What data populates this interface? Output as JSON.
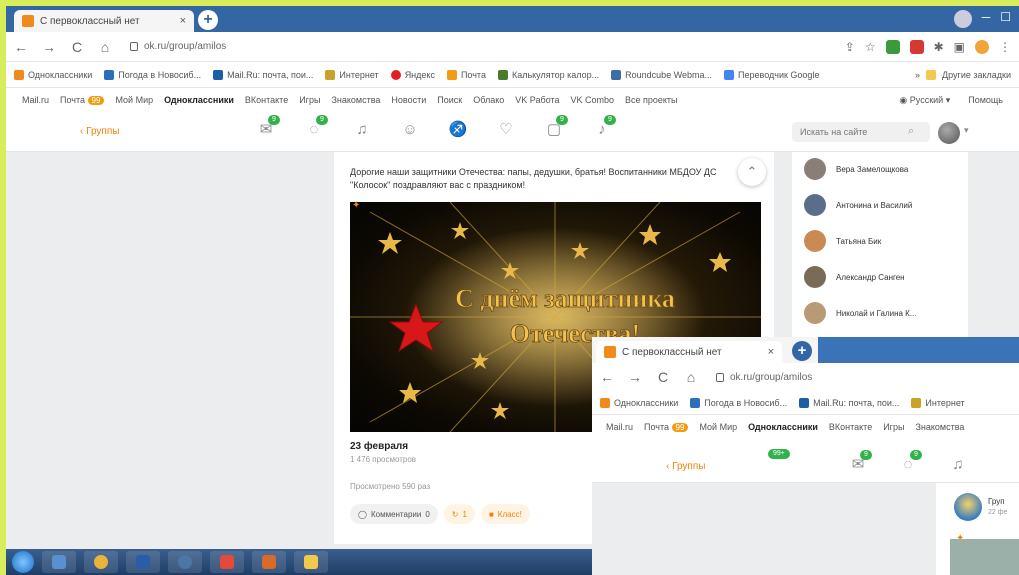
{
  "browser": {
    "tab_title": "С первоклассный нет",
    "tab_close": "×",
    "new_tab": "+",
    "url": "ok.ru/group/amilos"
  },
  "bookmarks": [
    {
      "label": "Одноклассники",
      "color": "#f08a1c"
    },
    {
      "label": "Погода в Новосиб...",
      "color": "#2a6fb8"
    },
    {
      "label": "Mail.Ru: почта, пои...",
      "color": "#1d5fa6"
    },
    {
      "label": "Интернет",
      "color": "#c9a227"
    },
    {
      "label": "Яндекс",
      "color": "#e02020"
    },
    {
      "label": "Почта",
      "color": "#f39c12"
    },
    {
      "label": "Калькулятор калор...",
      "color": "#4a7a2a"
    },
    {
      "label": "Roundcube Webma...",
      "color": "#3a6ea5"
    },
    {
      "label": "Переводчик Google",
      "color": "#4285f4"
    }
  ],
  "bookmarks_more": "Другие закладки",
  "portal": {
    "items": [
      "Mail.ru",
      "Почта",
      "Мой Мир",
      "Одноклассники",
      "ВКонтакте",
      "Игры",
      "Знакомства",
      "Новости",
      "Поиск",
      "Облако",
      "VK Работа",
      "VK Combo",
      "Все проекты"
    ],
    "mail_badge": "99",
    "lang": "Русский",
    "help": "Помощь"
  },
  "ok": {
    "back_label": "‹ Группы",
    "icons": [
      {
        "name": "messages-icon",
        "glyph": "✉",
        "count": "9"
      },
      {
        "name": "discussions-icon",
        "glyph": "💬",
        "count": "9"
      },
      {
        "name": "notifications-icon",
        "glyph": "🔔",
        "count": ""
      },
      {
        "name": "friends-icon",
        "glyph": "👥",
        "count": ""
      },
      {
        "name": "guests-icon",
        "glyph": "👣",
        "count": ""
      },
      {
        "name": "likes-icon",
        "glyph": "👍",
        "count": ""
      },
      {
        "name": "gifts-icon",
        "glyph": "🎁",
        "count": "9"
      },
      {
        "name": "music-icon",
        "glyph": "♫",
        "count": "9"
      }
    ],
    "search_placeholder": "Искать на сайте"
  },
  "post": {
    "text": "Дорогие наши защитники Отечества: папы, дедушки, братья! Воспитанники МБДОУ ДС \"Колосок\" поздравляют вас с праздником!",
    "date": "23 февраля",
    "subtitle": "1 476 просмотров",
    "views": "Просмотрено 590 раз",
    "comments_label": "Комментарии",
    "comments_count": "0",
    "likes_count": "1",
    "class_label": "Класс!",
    "image_text_line1": "С днём защитника",
    "image_text_line2": "Отечества!"
  },
  "friends": [
    {
      "name": "Вера Замелощкова",
      "color": "#8a7f78"
    },
    {
      "name": "Антонина и Василий",
      "color": "#5a6e8c"
    },
    {
      "name": "Татьяна Бик",
      "color": "#c98a55"
    },
    {
      "name": "Александр Санген",
      "color": "#7a6a58"
    },
    {
      "name": "Николай и Галина К...",
      "color": "#b79a76"
    }
  ],
  "overlay": {
    "tab_title": "С первоклассный нет",
    "url": "ok.ru/group/amilos",
    "bookmarks": [
      "Одноклассники",
      "Погода в Новосиб...",
      "Mail.Ru: почта, пои...",
      "Интернет"
    ],
    "portal_items": [
      "Mail.ru",
      "Почта",
      "Мой Мир",
      "Одноклассники",
      "ВКонтакте",
      "Игры",
      "Знакомства"
    ],
    "back_label": "‹ Группы",
    "green_pill": "99+",
    "counts": [
      "9",
      "9"
    ],
    "side_name": "Груп",
    "side_date": "22 фе"
  },
  "colors": {
    "accent": "#ee8208",
    "badge_green": "#2fb24c",
    "tab_blue": "#3466a3",
    "page_border": "#d7ee5a"
  }
}
